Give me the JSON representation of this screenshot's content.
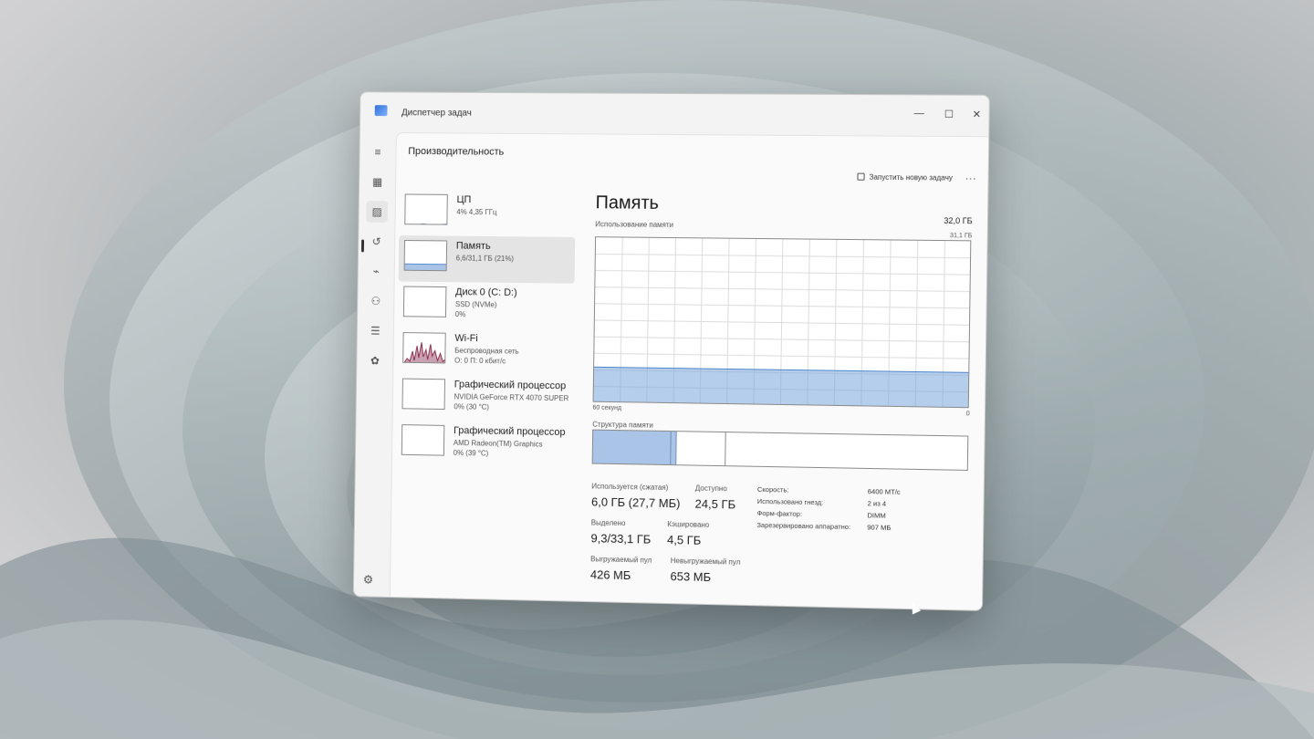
{
  "window": {
    "title": "Диспетчер задач"
  },
  "window_controls": {
    "minimize": "—",
    "maximize": "☐",
    "close": "✕"
  },
  "nav": {
    "items": [
      {
        "name": "menu-icon",
        "glyph": "≡"
      },
      {
        "name": "processes-icon",
        "glyph": "▦"
      },
      {
        "name": "performance-icon",
        "glyph": "▨"
      },
      {
        "name": "app-history-icon",
        "glyph": "↺"
      },
      {
        "name": "startup-icon",
        "glyph": "⌁"
      },
      {
        "name": "users-icon",
        "glyph": "⚇"
      },
      {
        "name": "details-icon",
        "glyph": "☰"
      },
      {
        "name": "services-icon",
        "glyph": "✿"
      }
    ],
    "settings_glyph": "⚙"
  },
  "header": {
    "title": "Производительность",
    "new_task_label": "Запустить новую задачу",
    "more_label": "..."
  },
  "cards": [
    {
      "title": "ЦП",
      "sub": "4% 4,35 ГГц",
      "sub2": ""
    },
    {
      "title": "Память",
      "sub": "6,6/31,1 ГБ (21%)",
      "sub2": ""
    },
    {
      "title": "Диск 0 (C: D:)",
      "sub": "SSD (NVMe)",
      "sub2": "0%"
    },
    {
      "title": "Wi-Fi",
      "sub": "Беспроводная сеть",
      "sub2": "О: 0 П: 0 кбит/с"
    },
    {
      "title": "Графический процессор",
      "sub": "NVIDIA GeForce RTX 4070 SUPER",
      "sub2": "0% (30 °C)"
    },
    {
      "title": "Графический процессор",
      "sub": "AMD Radeon(TM) Graphics",
      "sub2": "0% (39 °C)"
    }
  ],
  "detail": {
    "title": "Память",
    "usage_label": "Использование памяти",
    "total": "32,0 ГБ",
    "max": "31,1 ГБ",
    "axis_left": "60 секунд",
    "axis_right": "0",
    "structure_label": "Структура памяти",
    "usage_fraction": 0.21
  },
  "stats": {
    "in_use_label": "Используется (сжатая)",
    "in_use_value": "6,0 ГБ (27,7 МБ)",
    "available_label": "Доступно",
    "available_value": "24,5 ГБ",
    "committed_label": "Выделено",
    "committed_value": "9,3/33,1 ГБ",
    "cached_label": "Кэшировано",
    "cached_value": "4,5 ГБ",
    "paged_label": "Выгружаемый пул",
    "paged_value": "426 МБ",
    "nonpaged_label": "Невыгружаемый пул",
    "nonpaged_value": "653 МБ"
  },
  "specs": [
    {
      "label": "Скорость:",
      "value": "6400 MT/c"
    },
    {
      "label": "Использовано гнезд:",
      "value": "2 из 4"
    },
    {
      "label": "Форм-фактор:",
      "value": "DIMM"
    },
    {
      "label": "Зарезервировано аппаратно:",
      "value": "907 МБ"
    }
  ]
}
